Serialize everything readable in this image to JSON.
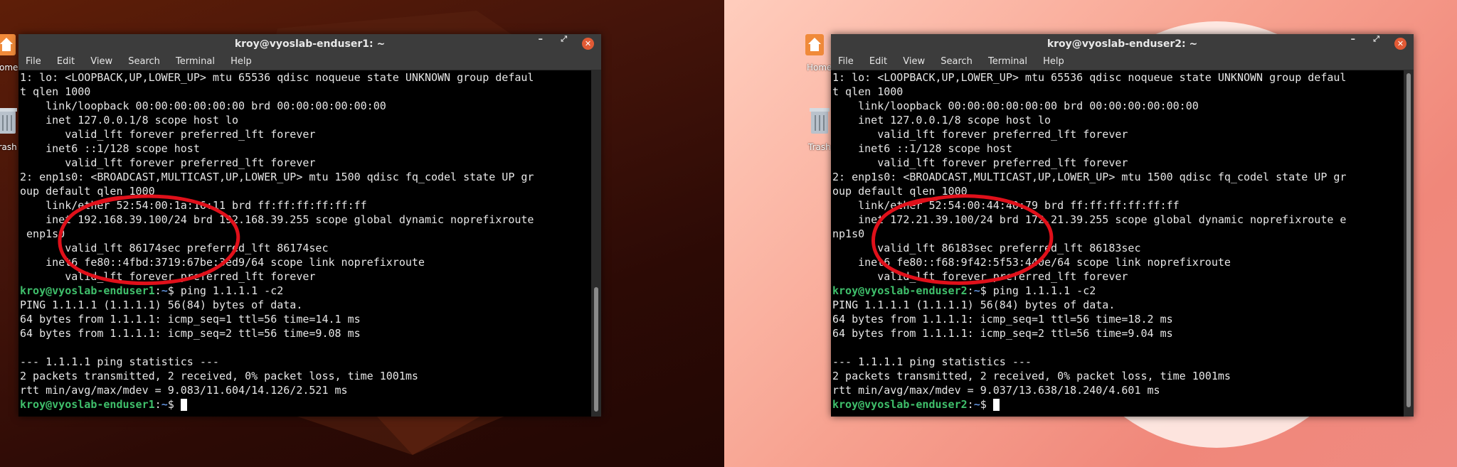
{
  "desktop": {
    "home_label": "Home",
    "trash_label": "Trash",
    "colors": {
      "left_bg": "#3a0f06",
      "right_bg": "#f49a8a",
      "prompt_green": "#3fbf6b",
      "path_blue": "#5e8ed6",
      "annotation_red": "#e0101a"
    }
  },
  "windows": [
    {
      "title": "kroy@vyoslab-enduser1: ~",
      "menu": [
        "File",
        "Edit",
        "View",
        "Search",
        "Terminal",
        "Help"
      ],
      "controls": {
        "minimize": "–",
        "maximize": "⤢",
        "close": "✕"
      },
      "lines": [
        "1: lo: <LOOPBACK,UP,LOWER_UP> mtu 65536 qdisc noqueue state UNKNOWN group defaul",
        "t qlen 1000",
        "    link/loopback 00:00:00:00:00:00 brd 00:00:00:00:00:00",
        "    inet 127.0.0.1/8 scope host lo",
        "       valid_lft forever preferred_lft forever",
        "    inet6 ::1/128 scope host",
        "       valid_lft forever preferred_lft forever",
        "2: enp1s0: <BROADCAST,MULTICAST,UP,LOWER_UP> mtu 1500 qdisc fq_codel state UP gr",
        "oup default qlen 1000",
        "    link/ether 52:54:00:1a:16:11 brd ff:ff:ff:ff:ff:ff",
        "    inet 192.168.39.100/24 brd 192.168.39.255 scope global dynamic noprefixroute",
        " enp1s0",
        "       valid_lft 86174sec preferred_lft 86174sec",
        "    inet6 fe80::4fbd:3719:67be:3ed9/64 scope link noprefixroute",
        "       valid_lft forever preferred_lft forever"
      ],
      "prompt_user": "kroy@vyoslab-enduser1",
      "prompt_path": "~",
      "prompt_symbol": "$",
      "command": " ping 1.1.1.1 -c2",
      "output": [
        "PING 1.1.1.1 (1.1.1.1) 56(84) bytes of data.",
        "64 bytes from 1.1.1.1: icmp_seq=1 ttl=56 time=14.1 ms",
        "64 bytes from 1.1.1.1: icmp_seq=2 ttl=56 time=9.08 ms",
        "",
        "--- 1.1.1.1 ping statistics ---",
        "2 packets transmitted, 2 received, 0% packet loss, time 1001ms",
        "rtt min/avg/max/mdev = 9.083/11.604/14.126/2.521 ms"
      ]
    },
    {
      "title": "kroy@vyoslab-enduser2: ~",
      "menu": [
        "File",
        "Edit",
        "View",
        "Search",
        "Terminal",
        "Help"
      ],
      "controls": {
        "minimize": "–",
        "maximize": "⤢",
        "close": "✕"
      },
      "lines": [
        "1: lo: <LOOPBACK,UP,LOWER_UP> mtu 65536 qdisc noqueue state UNKNOWN group defaul",
        "t qlen 1000",
        "    link/loopback 00:00:00:00:00:00 brd 00:00:00:00:00:00",
        "    inet 127.0.0.1/8 scope host lo",
        "       valid_lft forever preferred_lft forever",
        "    inet6 ::1/128 scope host",
        "       valid_lft forever preferred_lft forever",
        "2: enp1s0: <BROADCAST,MULTICAST,UP,LOWER_UP> mtu 1500 qdisc fq_codel state UP gr",
        "oup default qlen 1000",
        "    link/ether 52:54:00:44:40:79 brd ff:ff:ff:ff:ff:ff",
        "    inet 172.21.39.100/24 brd 172.21.39.255 scope global dynamic noprefixroute e",
        "np1s0",
        "       valid_lft 86183sec preferred_lft 86183sec",
        "    inet6 fe80::f68:9f42:5f53:440e/64 scope link noprefixroute",
        "       valid_lft forever preferred_lft forever"
      ],
      "prompt_user": "kroy@vyoslab-enduser2",
      "prompt_path": "~",
      "prompt_symbol": "$",
      "command": " ping 1.1.1.1 -c2",
      "output": [
        "PING 1.1.1.1 (1.1.1.1) 56(84) bytes of data.",
        "64 bytes from 1.1.1.1: icmp_seq=1 ttl=56 time=18.2 ms",
        "64 bytes from 1.1.1.1: icmp_seq=2 ttl=56 time=9.04 ms",
        "",
        "--- 1.1.1.1 ping statistics ---",
        "2 packets transmitted, 2 received, 0% packet loss, time 1001ms",
        "rtt min/avg/max/mdev = 9.037/13.638/18.240/4.601 ms"
      ]
    }
  ]
}
